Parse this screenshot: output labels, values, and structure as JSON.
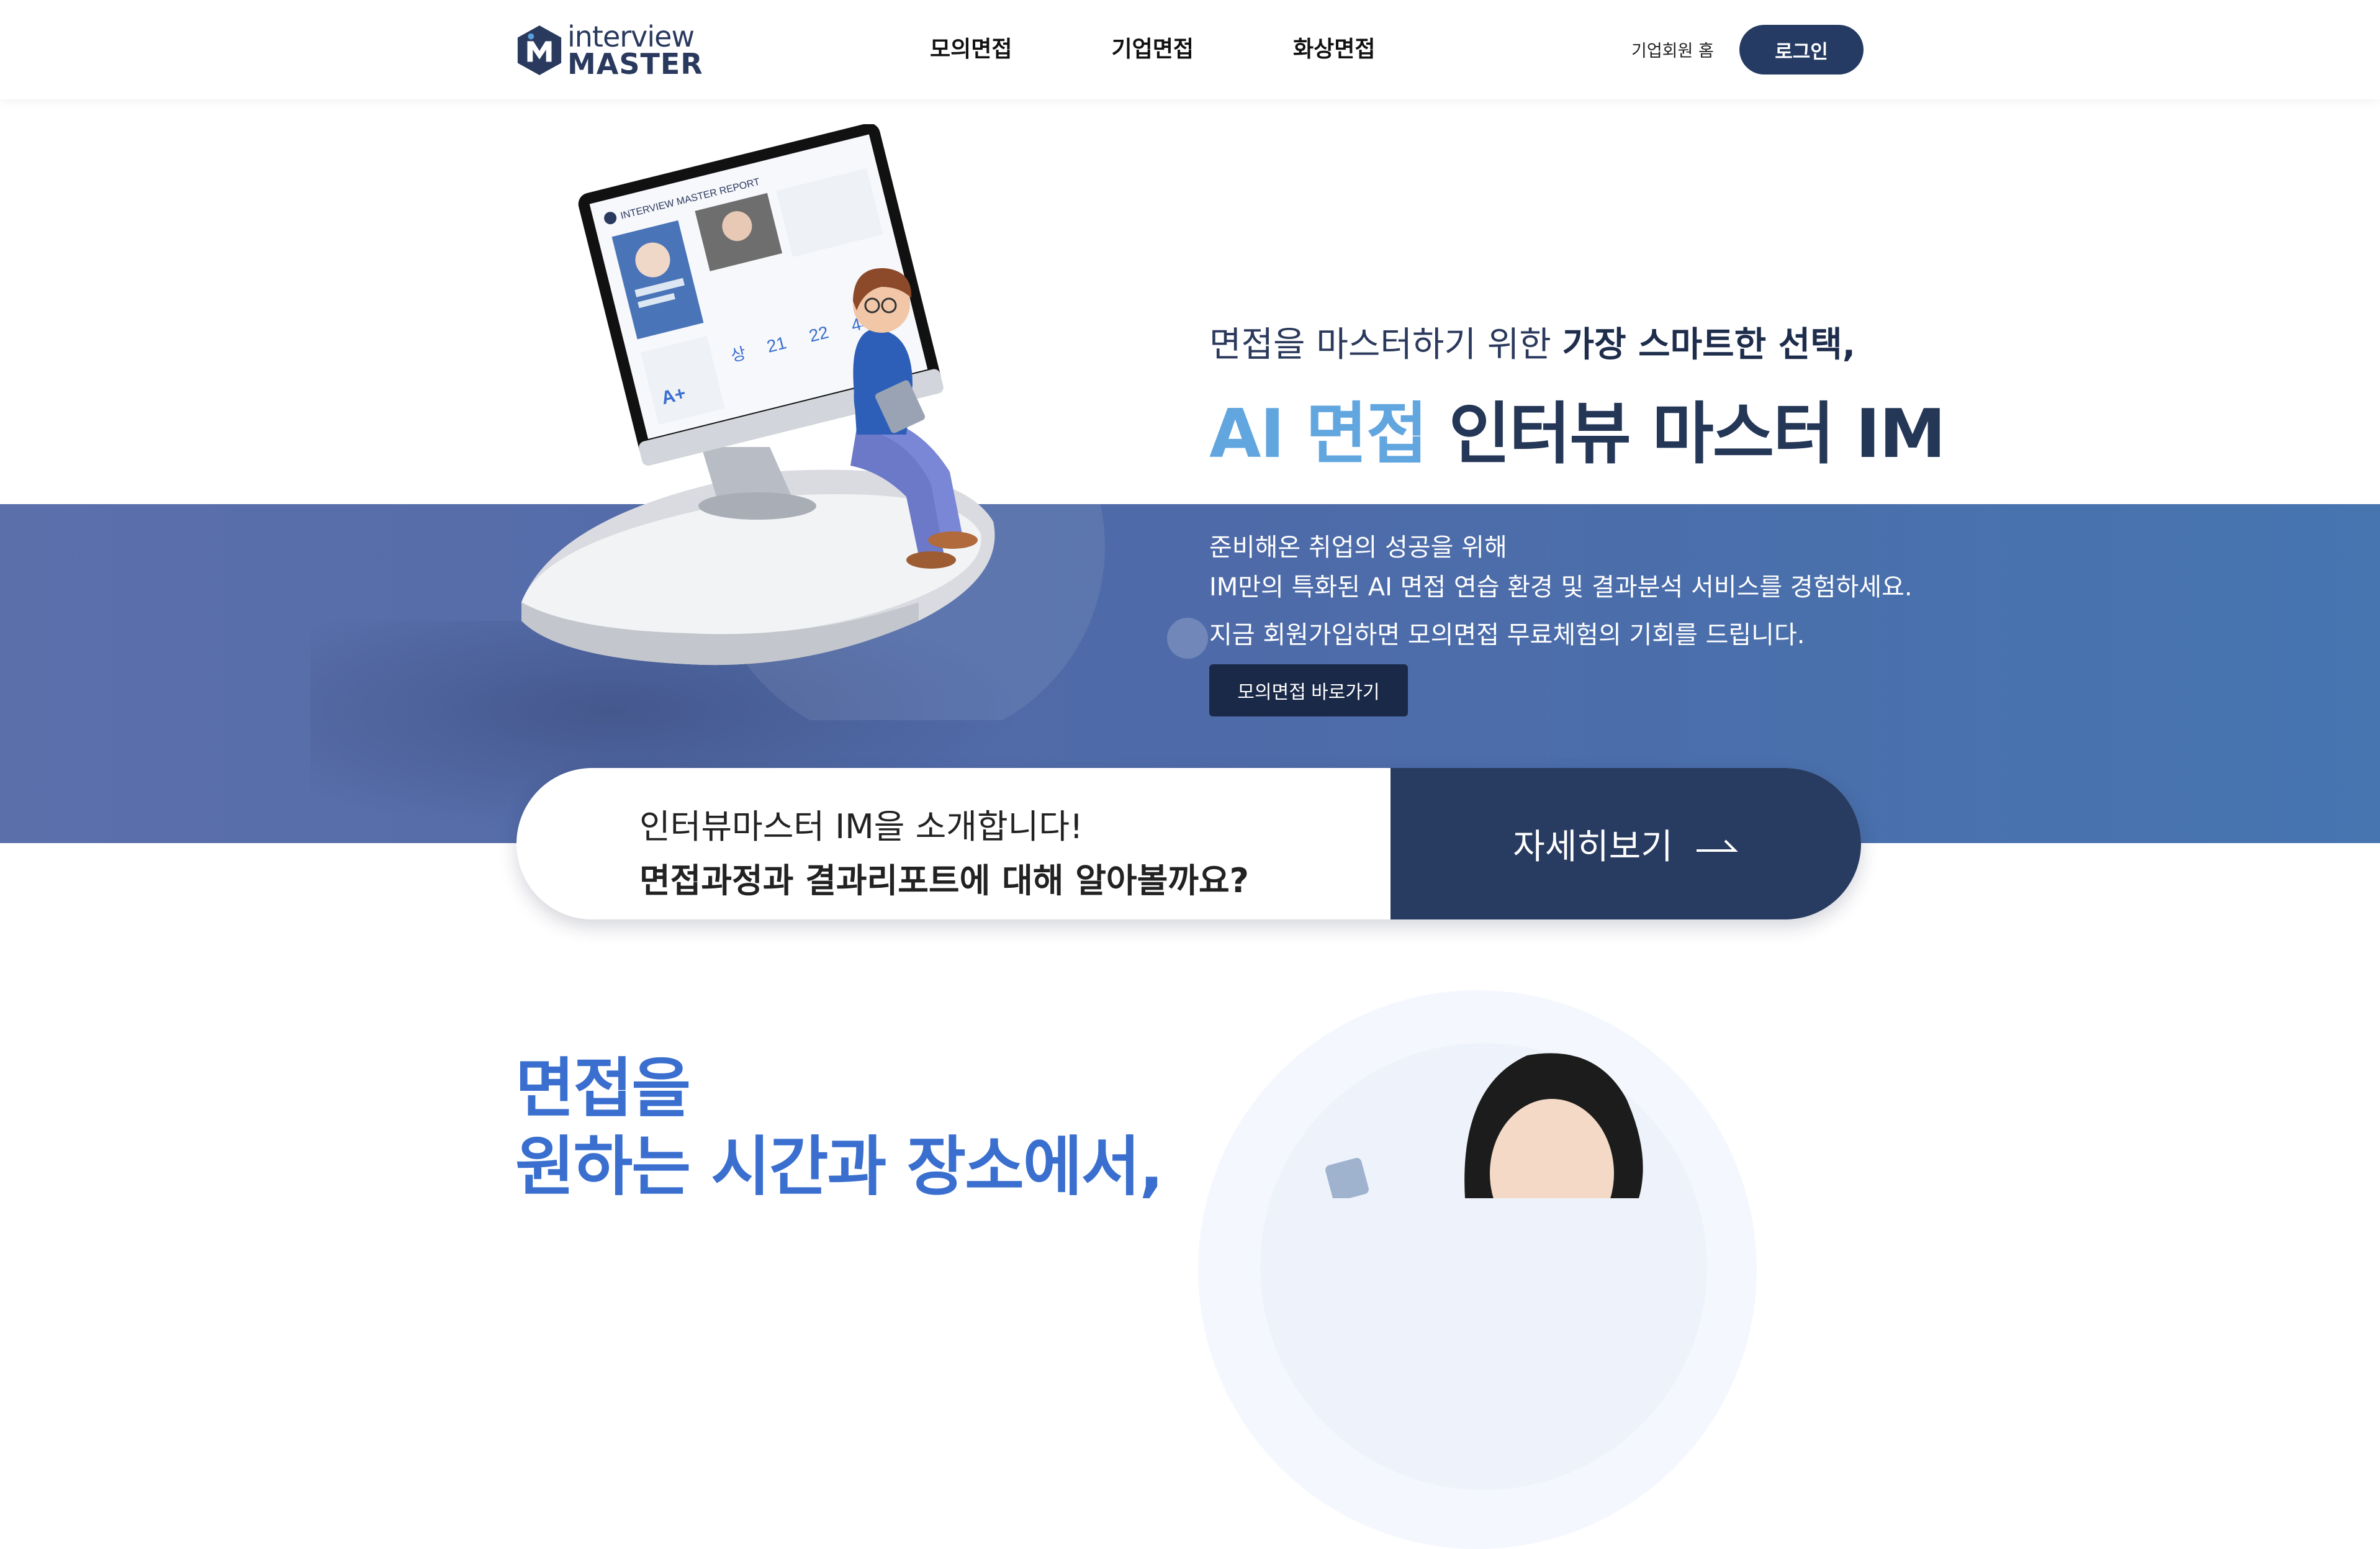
{
  "header": {
    "logo": {
      "line1": "interview",
      "line2": "MASTER"
    },
    "nav": [
      "모의면접",
      "기업면접",
      "화상면접"
    ],
    "biz_home": "기업회원 홈",
    "login": "로그인"
  },
  "hero": {
    "tagline_normal": "면접을 마스터하기 위한 ",
    "tagline_bold": "가장 스마트한 선택,",
    "headline_accent": "AI 면접",
    "headline_rest": " 인터뷰 마스터 IM",
    "desc_line1": "준비해온 취업의 성공을 위해",
    "desc_line2": "IM만의 특화된 AI 면접 연습 환경 및 결과분석 서비스를 경험하세요.",
    "desc_line3": "지금 회원가입하면 모의면접 무료체험의 기회를 드립니다.",
    "cta": "모의면접 바로가기"
  },
  "monitor": {
    "report_title": "INTERVIEW MASTER REPORT",
    "grade": "A+",
    "grade_label": "상",
    "scores": [
      "21",
      "22",
      "44"
    ]
  },
  "intro": {
    "line1": "인터뷰마스터 IM을 소개합니다!",
    "line2": "면접과정과 결과리포트에 대해 알아볼까요?",
    "more": "자세히보기"
  },
  "section2": {
    "title_line1": "면접을",
    "title_line2": "원하는 시간과 장소에서,"
  },
  "colors": {
    "navy": "#253b63",
    "accent_blue": "#62a6e0",
    "band_blue": "#4e6aa8",
    "section_blue": "#3a6fcf"
  }
}
